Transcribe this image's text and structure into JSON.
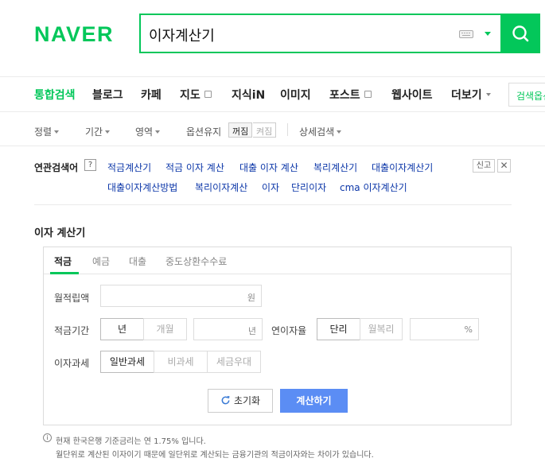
{
  "brand": {
    "logo": "NAVER",
    "color": "#03c75a"
  },
  "search": {
    "query": "이자계산기",
    "keyboard_icon": "keyboard-icon",
    "dropdown_icon": "chevron-down-icon",
    "submit_icon": "search-icon"
  },
  "tabs": [
    {
      "label": "통합검색",
      "active": true
    },
    {
      "label": "블로그"
    },
    {
      "label": "카페"
    },
    {
      "label": "지도"
    },
    {
      "label": "지식iN"
    },
    {
      "label": "이미지"
    },
    {
      "label": "포스트"
    },
    {
      "label": "웹사이트"
    },
    {
      "label": "더보기"
    }
  ],
  "search_tool_label": "검색옵션",
  "options": {
    "sort": "정렬",
    "period": "기간",
    "area": "영역",
    "keep_option": "옵션유지",
    "off": "꺼짐",
    "on": "켜짐",
    "advanced": "상세검색"
  },
  "related": {
    "title": "연관검색어",
    "help": "?",
    "row1": [
      "적금계산기",
      "적금 이자 계산",
      "대출 이자 계산",
      "복리계산기",
      "대출이자계산기"
    ],
    "row2": [
      "대출이자계산방법",
      "복리이자계산",
      "이자",
      "단리이자",
      "cma 이자계산기"
    ],
    "report": "신고",
    "close": "✕"
  },
  "calculator": {
    "title": "이자 계산기",
    "tabs": [
      "적금",
      "예금",
      "대출",
      "중도상환수수료"
    ],
    "monthly_deposit_label": "월적립액",
    "won_unit": "원",
    "period_label": "적금기간",
    "period_year": "년",
    "period_month": "개월",
    "year_unit": "년",
    "rate_label": "연이자율",
    "simple": "단리",
    "compound": "월복리",
    "percent_unit": "%",
    "tax_label": "이자과세",
    "tax_general": "일반과세",
    "tax_free": "비과세",
    "tax_favored": "세금우대",
    "reset": "초기화",
    "calculate": "계산하기"
  },
  "notes": {
    "line1": "현재 한국은행 기준금리는 연 1.75% 입니다.",
    "line2": "월단위로 계산된 이자이기 때문에 일단위로 계산되는 금융기관의 적금이자와는 차이가 있습니다."
  }
}
